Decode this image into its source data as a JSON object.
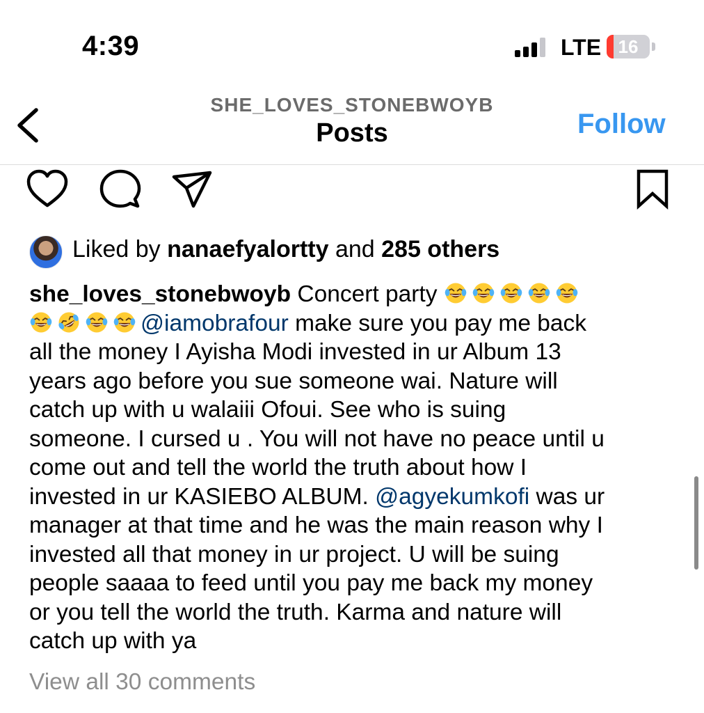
{
  "status_bar": {
    "time": "4:39",
    "network": "LTE",
    "battery_level": "16",
    "battery_fraction": 0.16,
    "signal_icon": "cellular-signal-icon",
    "battery_icon": "battery-icon"
  },
  "header": {
    "username": "SHE_LOVES_STONEBWOYB",
    "title": "Posts",
    "follow_label": "Follow",
    "back_icon": "chevron-left-icon",
    "accent_color": "#3897f0"
  },
  "actions": {
    "like_icon": "heart-icon",
    "comment_icon": "comment-bubble-icon",
    "share_icon": "paper-plane-icon",
    "save_icon": "bookmark-icon"
  },
  "likes": {
    "prefix": "Liked by ",
    "liker": "nanaefyalortty",
    "connector": " and ",
    "others": "285 others"
  },
  "caption": {
    "author": "she_loves_stonebwoyb",
    "lead_text": " Concert party ",
    "mention_1": "@iamobrafour",
    "line_2_text": " make sure you pay me back",
    "line_3": "all the money I Ayisha Modi invested in ur Album 13",
    "line_4": "years ago before you sue someone wai. Nature will",
    "line_5": "catch up with u walaiii Ofoui. See who is suing",
    "line_6": "someone. I cursed u . You will not have no peace until u",
    "line_7": "come out and tell the world the truth about how I",
    "line_8_text": "invested in ur KASIEBO ALBUM. ",
    "mention_2": "@agyekumkofi",
    "line_8_tail": " was ur",
    "line_9": "manager at that time and he was the main reason why I",
    "line_10": "invested all that money in ur project. U will be suing",
    "line_11": "people saaaa to feed until you pay me back my money",
    "line_12": "or you tell the world the truth. Karma and nature will",
    "line_13": "catch up with ya",
    "emojis_line_1": [
      "face-with-tears-of-joy",
      "face-with-tears-of-joy",
      "face-with-tears-of-joy",
      "face-with-tears-of-joy",
      "face-with-tears-of-joy"
    ],
    "emojis_line_2": [
      "face-with-tears-of-joy",
      "rolling-on-the-floor-laughing",
      "face-with-tears-of-joy",
      "face-with-tears-of-joy"
    ],
    "mention_color": "#00376b"
  },
  "comments": {
    "view_all_label": "View all 30 comments"
  }
}
